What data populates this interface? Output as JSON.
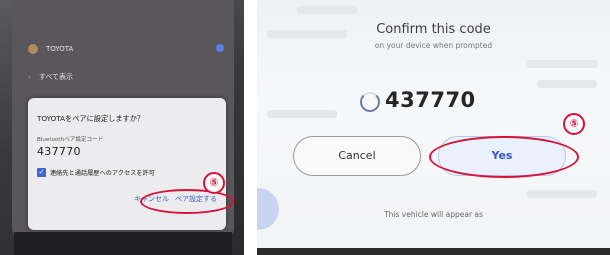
{
  "left_phone": {
    "background_rows": [
      "TOYOTA",
      "すべて表示"
    ],
    "dialog": {
      "title": "TOYOTAをペアに設定しますか？",
      "code_label": "Bluetoothペア設定コード",
      "code": "437770",
      "checkbox_label": "連絡先と通話履歴へのアクセスを許可",
      "checkbox_checked": true,
      "cancel_label": "キャンセル",
      "pair_label": "ペア設定する"
    },
    "step_badge": "⑤"
  },
  "right_screen": {
    "title": "Confirm this code",
    "subtitle": "on your device when prompted",
    "code": "437770",
    "cancel_label": "Cancel",
    "yes_label": "Yes",
    "note": "This vehicle will appear as",
    "step_badge": "⑤"
  },
  "colors": {
    "annotation_red": "#d4143a",
    "yes_blue": "#3656c4",
    "checkbox_blue": "#3f66d6"
  }
}
